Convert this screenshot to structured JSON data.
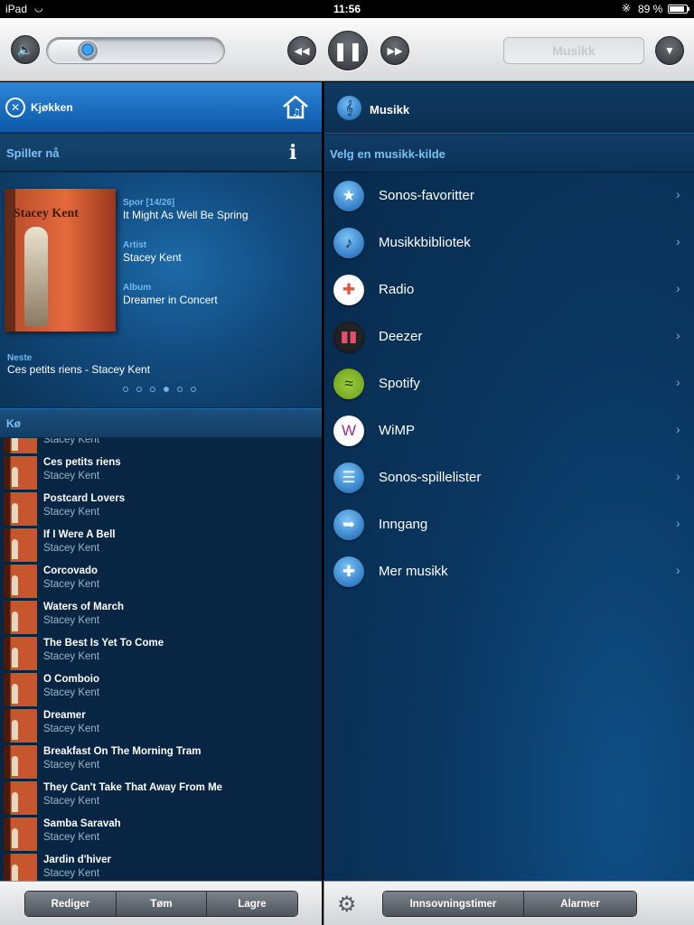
{
  "status_bar": {
    "carrier": "iPad",
    "time": "11:56",
    "battery": "89 %",
    "battery_level": 0.89
  },
  "transport": {
    "volume_level": 0.22,
    "source_placeholder": "Musikk"
  },
  "left": {
    "room": "Kjøkken",
    "now_playing_title": "Spiller nå",
    "info": "i",
    "track_label": "Spor [14/26]",
    "track": "It Might As Well Be Spring",
    "artist_label": "Artist",
    "artist": "Stacey Kent",
    "album_label": "Album",
    "album": "Dreamer in Concert",
    "next_label": "Neste",
    "next": "Ces petits riens - Stacey Kent",
    "page_count": 6,
    "page_active": 3,
    "queue_title": "Kø",
    "queue_partial_artist": "Stacey Kent",
    "queue": [
      {
        "title": "Ces petits riens",
        "artist": "Stacey Kent"
      },
      {
        "title": "Postcard Lovers",
        "artist": "Stacey Kent"
      },
      {
        "title": "If I Were A Bell",
        "artist": "Stacey Kent"
      },
      {
        "title": "Corcovado",
        "artist": "Stacey Kent"
      },
      {
        "title": "Waters of March",
        "artist": "Stacey Kent"
      },
      {
        "title": "The Best Is Yet To Come",
        "artist": "Stacey Kent"
      },
      {
        "title": "O Comboio",
        "artist": "Stacey Kent"
      },
      {
        "title": "Dreamer",
        "artist": "Stacey Kent"
      },
      {
        "title": "Breakfast On The Morning Tram",
        "artist": "Stacey Kent"
      },
      {
        "title": "They Can't Take That Away From Me",
        "artist": "Stacey Kent"
      },
      {
        "title": "Samba Saravah",
        "artist": "Stacey Kent"
      },
      {
        "title": "Jardin d'hiver",
        "artist": "Stacey Kent"
      }
    ],
    "buttons": {
      "edit": "Rediger",
      "clear": "Tøm",
      "save": "Lagre"
    }
  },
  "right": {
    "title": "Musikk",
    "subtitle": "Velg en musikk-kilde",
    "sources": [
      {
        "label": "Sonos-favoritter",
        "icon": "star-icon"
      },
      {
        "label": "Musikkbibliotek",
        "icon": "music-note-icon"
      },
      {
        "label": "Radio",
        "icon": "radio-icon"
      },
      {
        "label": "Deezer",
        "icon": "deezer-icon"
      },
      {
        "label": "Spotify",
        "icon": "spotify-icon"
      },
      {
        "label": "WiMP",
        "icon": "wimp-icon"
      },
      {
        "label": "Sonos-spillelister",
        "icon": "playlist-icon"
      },
      {
        "label": "Inngang",
        "icon": "line-in-icon"
      },
      {
        "label": "Mer musikk",
        "icon": "plus-icon"
      }
    ],
    "buttons": {
      "sleep": "Innsovningstimer",
      "alarms": "Alarmer"
    }
  },
  "album_art_text": "Stacey Kent"
}
